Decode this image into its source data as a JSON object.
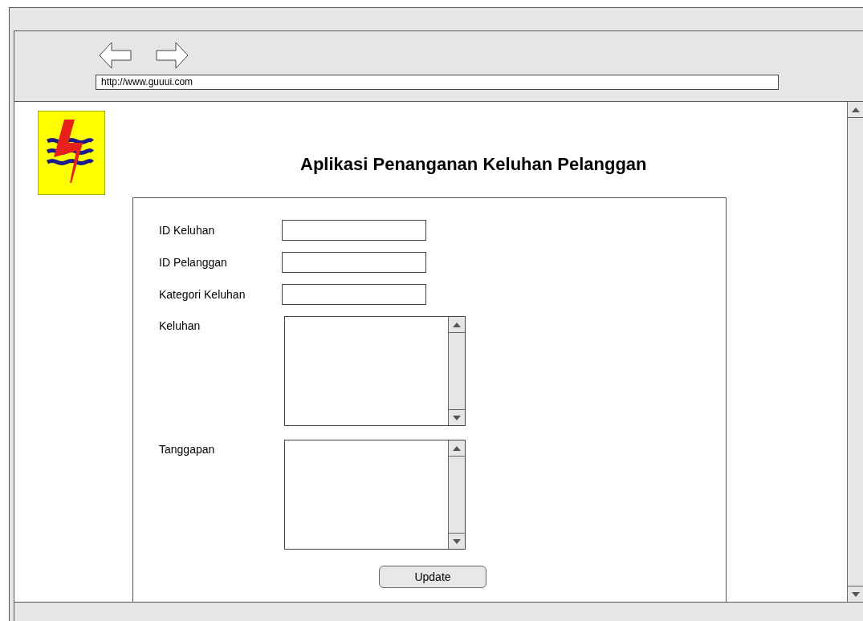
{
  "browser": {
    "url": "http://www.guuui.com"
  },
  "page": {
    "title": "Aplikasi Penanganan Keluhan Pelanggan"
  },
  "form": {
    "fields": [
      {
        "label": "ID Keluhan",
        "kind": "input"
      },
      {
        "label": "ID Pelanggan",
        "kind": "input"
      },
      {
        "label": "Kategori Keluhan",
        "kind": "input"
      },
      {
        "label": "Keluhan",
        "kind": "textarea"
      },
      {
        "label": "Tanggapan",
        "kind": "textarea"
      }
    ],
    "button": "Update"
  }
}
